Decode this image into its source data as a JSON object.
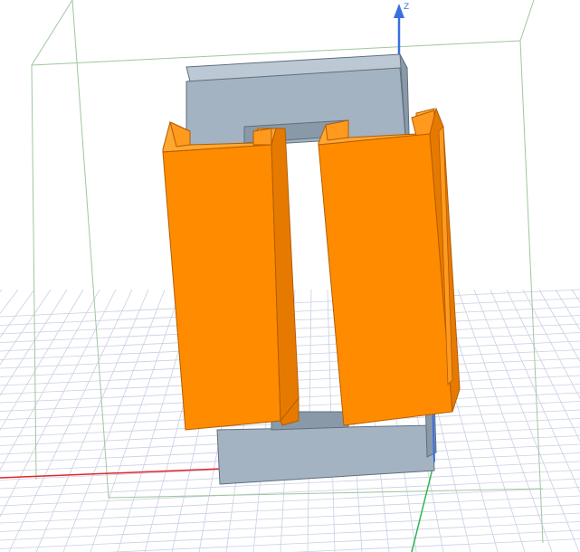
{
  "viewport": {
    "background_color": "#ffffff"
  },
  "axes": {
    "z_label": "Z",
    "x_color": "#e0262b",
    "y_color": "#2fb24a",
    "z_color": "#3a6fe0"
  },
  "model": {
    "core_color": "#a3b3c2",
    "core_top_color": "#bcc8d3",
    "core_side_color": "#8a99a8",
    "coil_color": "#ff8c00",
    "coil_side_color": "#e67a00",
    "coil_top_color": "#ffa733"
  },
  "scene": {
    "grid_color": "#c9cfe6",
    "bounding_box_color": "#9fc79f"
  }
}
